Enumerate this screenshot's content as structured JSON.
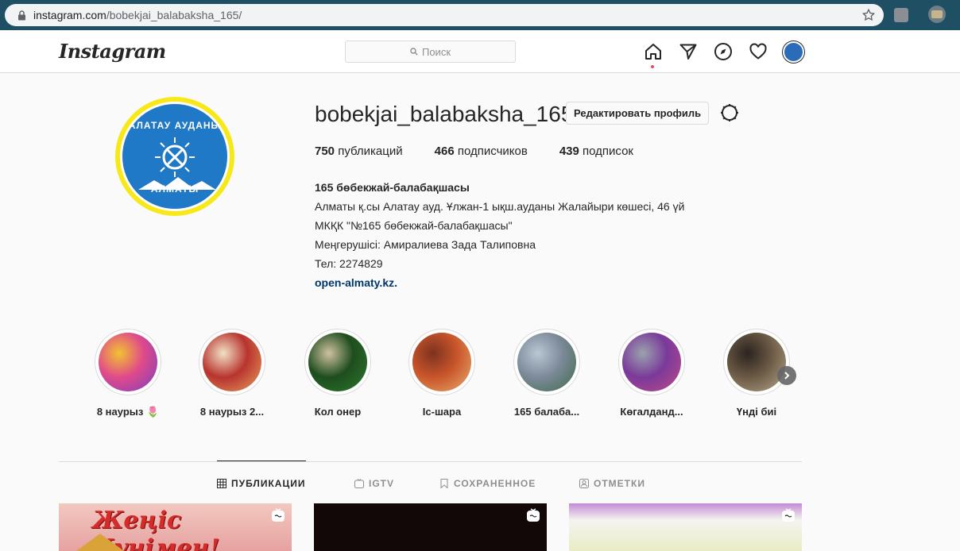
{
  "browser": {
    "url_host": "instagram.com",
    "url_path": "/bobekjai_balabaksha_165/"
  },
  "nav": {
    "logo": "Instagram",
    "search_placeholder": "Поиск"
  },
  "profile": {
    "username": "bobekjai_balabaksha_165",
    "edit_button": "Редактировать профиль",
    "avatar_top_text": "АЛАТАУ АУДАНЫ",
    "avatar_bottom_text": "АЛМАТЫ",
    "stats": [
      {
        "count": "750",
        "label": "публикаций"
      },
      {
        "count": "466",
        "label": "подписчиков"
      },
      {
        "count": "439",
        "label": "подписок"
      }
    ],
    "bio_name": "165 бөбекжай-балабақшасы",
    "bio_lines": [
      "Алматы қ.сы Алатау ауд. Ұлжан-1 ықш.ауданы Жалайыри көшесі, 46 үй",
      "МКҚК \"№165 бөбекжай-балабақшасы\"",
      "Меңгерушісі: Амиралиева Зада Талиповна",
      "Тел: 2274829"
    ],
    "bio_link": "open-almaty.kz."
  },
  "highlights": [
    {
      "label": "8 наурыз 🌷",
      "colors": [
        "#e04a8a",
        "#7a3fbf",
        "#f2c230"
      ]
    },
    {
      "label": "8 наурыз 2...",
      "colors": [
        "#b8342f",
        "#e8a25d",
        "#f2e1c4"
      ]
    },
    {
      "label": "Кол онер",
      "colors": [
        "#1e4d1e",
        "#2d7a2d",
        "#cfc2a0"
      ]
    },
    {
      "label": "Іс-шара",
      "colors": [
        "#c9552b",
        "#e8b070",
        "#7c3220"
      ]
    },
    {
      "label": "165 балаба...",
      "colors": [
        "#7c8a9a",
        "#3d6b45",
        "#b9c6d3"
      ]
    },
    {
      "label": "Көгалданд...",
      "colors": [
        "#7a3a99",
        "#c24a8a",
        "#9aa3ad"
      ]
    },
    {
      "label": "Үнді биі",
      "colors": [
        "#6b5a45",
        "#b9a98d",
        "#2c2420"
      ]
    }
  ],
  "tabs": [
    {
      "label": "ПУБЛИКАЦИИ",
      "active": true
    },
    {
      "label": "IGTV",
      "active": false
    },
    {
      "label": "СОХРАНЕННОЕ",
      "active": false
    },
    {
      "label": "ОТМЕТКИ",
      "active": false
    }
  ],
  "posts": [
    {
      "text": "Жеңіс Күнімен!"
    },
    {
      "text": ""
    },
    {
      "text": ""
    }
  ],
  "colors": {
    "link": "#00376b",
    "notification_dot": "#ed4956",
    "browser_frame": "#1f4f63"
  }
}
